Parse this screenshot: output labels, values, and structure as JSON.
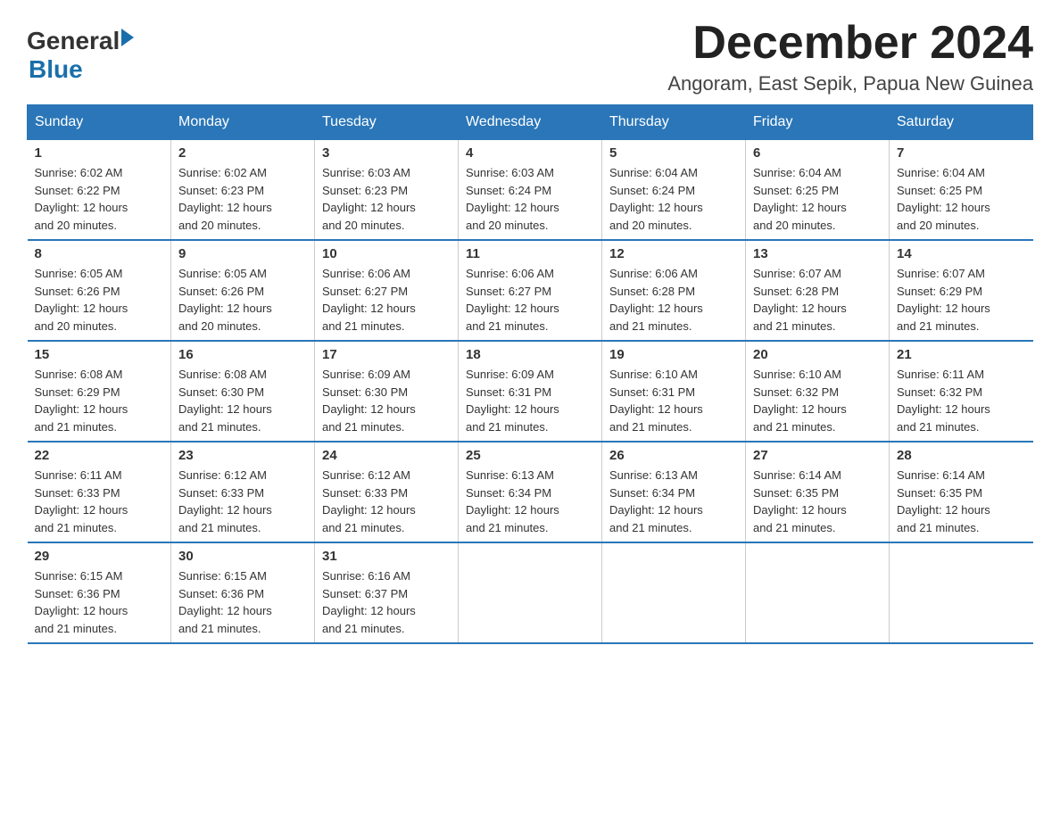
{
  "header": {
    "logo": {
      "general": "General",
      "arrow": "▶",
      "blue": "Blue"
    },
    "month_title": "December 2024",
    "location": "Angoram, East Sepik, Papua New Guinea"
  },
  "days_of_week": [
    "Sunday",
    "Monday",
    "Tuesday",
    "Wednesday",
    "Thursday",
    "Friday",
    "Saturday"
  ],
  "weeks": [
    [
      {
        "day": 1,
        "sunrise": "6:02 AM",
        "sunset": "6:22 PM",
        "daylight": "12 hours and 20 minutes."
      },
      {
        "day": 2,
        "sunrise": "6:02 AM",
        "sunset": "6:23 PM",
        "daylight": "12 hours and 20 minutes."
      },
      {
        "day": 3,
        "sunrise": "6:03 AM",
        "sunset": "6:23 PM",
        "daylight": "12 hours and 20 minutes."
      },
      {
        "day": 4,
        "sunrise": "6:03 AM",
        "sunset": "6:24 PM",
        "daylight": "12 hours and 20 minutes."
      },
      {
        "day": 5,
        "sunrise": "6:04 AM",
        "sunset": "6:24 PM",
        "daylight": "12 hours and 20 minutes."
      },
      {
        "day": 6,
        "sunrise": "6:04 AM",
        "sunset": "6:25 PM",
        "daylight": "12 hours and 20 minutes."
      },
      {
        "day": 7,
        "sunrise": "6:04 AM",
        "sunset": "6:25 PM",
        "daylight": "12 hours and 20 minutes."
      }
    ],
    [
      {
        "day": 8,
        "sunrise": "6:05 AM",
        "sunset": "6:26 PM",
        "daylight": "12 hours and 20 minutes."
      },
      {
        "day": 9,
        "sunrise": "6:05 AM",
        "sunset": "6:26 PM",
        "daylight": "12 hours and 20 minutes."
      },
      {
        "day": 10,
        "sunrise": "6:06 AM",
        "sunset": "6:27 PM",
        "daylight": "12 hours and 21 minutes."
      },
      {
        "day": 11,
        "sunrise": "6:06 AM",
        "sunset": "6:27 PM",
        "daylight": "12 hours and 21 minutes."
      },
      {
        "day": 12,
        "sunrise": "6:06 AM",
        "sunset": "6:28 PM",
        "daylight": "12 hours and 21 minutes."
      },
      {
        "day": 13,
        "sunrise": "6:07 AM",
        "sunset": "6:28 PM",
        "daylight": "12 hours and 21 minutes."
      },
      {
        "day": 14,
        "sunrise": "6:07 AM",
        "sunset": "6:29 PM",
        "daylight": "12 hours and 21 minutes."
      }
    ],
    [
      {
        "day": 15,
        "sunrise": "6:08 AM",
        "sunset": "6:29 PM",
        "daylight": "12 hours and 21 minutes."
      },
      {
        "day": 16,
        "sunrise": "6:08 AM",
        "sunset": "6:30 PM",
        "daylight": "12 hours and 21 minutes."
      },
      {
        "day": 17,
        "sunrise": "6:09 AM",
        "sunset": "6:30 PM",
        "daylight": "12 hours and 21 minutes."
      },
      {
        "day": 18,
        "sunrise": "6:09 AM",
        "sunset": "6:31 PM",
        "daylight": "12 hours and 21 minutes."
      },
      {
        "day": 19,
        "sunrise": "6:10 AM",
        "sunset": "6:31 PM",
        "daylight": "12 hours and 21 minutes."
      },
      {
        "day": 20,
        "sunrise": "6:10 AM",
        "sunset": "6:32 PM",
        "daylight": "12 hours and 21 minutes."
      },
      {
        "day": 21,
        "sunrise": "6:11 AM",
        "sunset": "6:32 PM",
        "daylight": "12 hours and 21 minutes."
      }
    ],
    [
      {
        "day": 22,
        "sunrise": "6:11 AM",
        "sunset": "6:33 PM",
        "daylight": "12 hours and 21 minutes."
      },
      {
        "day": 23,
        "sunrise": "6:12 AM",
        "sunset": "6:33 PM",
        "daylight": "12 hours and 21 minutes."
      },
      {
        "day": 24,
        "sunrise": "6:12 AM",
        "sunset": "6:33 PM",
        "daylight": "12 hours and 21 minutes."
      },
      {
        "day": 25,
        "sunrise": "6:13 AM",
        "sunset": "6:34 PM",
        "daylight": "12 hours and 21 minutes."
      },
      {
        "day": 26,
        "sunrise": "6:13 AM",
        "sunset": "6:34 PM",
        "daylight": "12 hours and 21 minutes."
      },
      {
        "day": 27,
        "sunrise": "6:14 AM",
        "sunset": "6:35 PM",
        "daylight": "12 hours and 21 minutes."
      },
      {
        "day": 28,
        "sunrise": "6:14 AM",
        "sunset": "6:35 PM",
        "daylight": "12 hours and 21 minutes."
      }
    ],
    [
      {
        "day": 29,
        "sunrise": "6:15 AM",
        "sunset": "6:36 PM",
        "daylight": "12 hours and 21 minutes."
      },
      {
        "day": 30,
        "sunrise": "6:15 AM",
        "sunset": "6:36 PM",
        "daylight": "12 hours and 21 minutes."
      },
      {
        "day": 31,
        "sunrise": "6:16 AM",
        "sunset": "6:37 PM",
        "daylight": "12 hours and 21 minutes."
      },
      null,
      null,
      null,
      null
    ]
  ],
  "labels": {
    "sunrise": "Sunrise:",
    "sunset": "Sunset:",
    "daylight": "Daylight:"
  }
}
